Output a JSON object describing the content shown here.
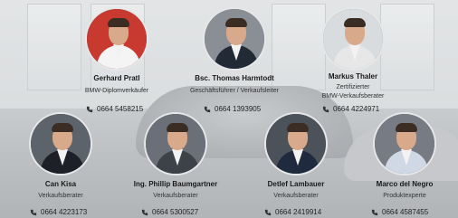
{
  "team": [
    {
      "name": "Gerhard Pratl",
      "role": [
        "BMW-Diplomverkäufer"
      ],
      "phone": "0664 5458215",
      "icon": "phone-icon",
      "bg": "#c8392f",
      "body": "#f4f4f4"
    },
    {
      "name": "Bsc. Thomas Harmtodt",
      "role": [
        "Geschäftsführer / Verkaufsleiter"
      ],
      "phone": "0664 1393905",
      "icon": "phone-icon",
      "bg": "#8a8f96",
      "body": "#222a36"
    },
    {
      "name": "Markus Thaler",
      "role": [
        "Zertifizierter",
        "BMW-Verkaufsberater"
      ],
      "phone": "0664 4224971",
      "icon": "phone-icon",
      "bg": "#d9dcdf",
      "body": "#e7e7e7"
    },
    {
      "name": "Can Kisa",
      "role": [
        "Verkaufsberater"
      ],
      "phone": "0664 4223173",
      "icon": "phone-icon",
      "bg": "#5d636b",
      "body": "#1d2026"
    },
    {
      "name": "Ing. Phillip Baumgartner",
      "role": [
        "Verkaufsberater"
      ],
      "phone": "0664 5300527",
      "icon": "phone-icon",
      "bg": "#6b7078",
      "body": "#3d4148"
    },
    {
      "name": "Detlef Lambauer",
      "role": [
        "Verkaufsberater"
      ],
      "phone": "0664 2419914",
      "icon": "phone-icon",
      "bg": "#4c525a",
      "body": "#1f2a3e"
    },
    {
      "name": "Marco del Negro",
      "role": [
        "Produktexperte"
      ],
      "phone": "0664 4587455",
      "icon": "phone-icon",
      "bg": "#777c84",
      "body": "#cfd8e4"
    }
  ]
}
